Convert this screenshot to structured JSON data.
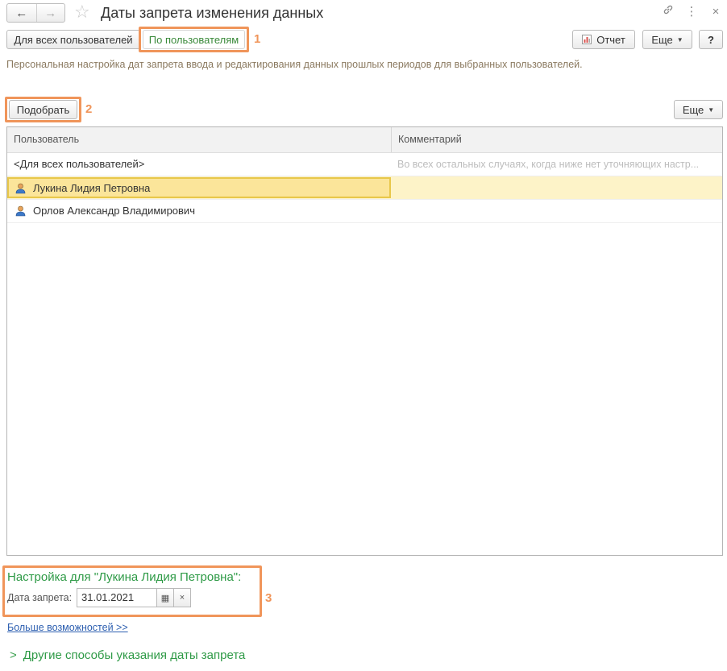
{
  "window": {
    "title": "Даты запрета изменения данных",
    "back_icon": "←",
    "forward_icon": "→",
    "star_icon": "☆",
    "link_icon": "🔗",
    "menu_icon": "⋮",
    "close_icon": "×"
  },
  "toolbar": {
    "tab_all_users": "Для всех пользователей",
    "tab_by_users": "По пользователям",
    "marker_1": "1",
    "report_label": "Отчет",
    "more_label": "Еще",
    "help_label": "?"
  },
  "description": "Персональная настройка дат запрета ввода и редактирования данных прошлых периодов для выбранных пользователей.",
  "list_toolbar": {
    "pick_label": "Подобрать",
    "marker_2": "2",
    "more_label": "Еще"
  },
  "table": {
    "columns": [
      "Пользователь",
      "Комментарий"
    ],
    "rows": [
      {
        "user": "<Для всех пользователей>",
        "comment": "Во всех остальных случаях, когда ниже нет уточняющих настр..."
      },
      {
        "user": "Лукина Лидия Петровна",
        "comment": ""
      },
      {
        "user": "Орлов Александр Владимирович",
        "comment": ""
      }
    ]
  },
  "settings": {
    "title": "Настройка для \"Лукина Лидия Петровна\":",
    "date_label": "Дата запрета:",
    "date_value": "31.01.2021",
    "marker_3": "3",
    "calendar_icon": "▦",
    "clear_icon": "×"
  },
  "more_link": "Больше возможностей >>",
  "other_methods": "Другие способы указания даты запрета",
  "colors": {
    "accent_green": "#2e9a46",
    "highlight_orange": "#f0955a",
    "selected_row": "#fdf3c8",
    "link_blue": "#2d5fb0"
  }
}
